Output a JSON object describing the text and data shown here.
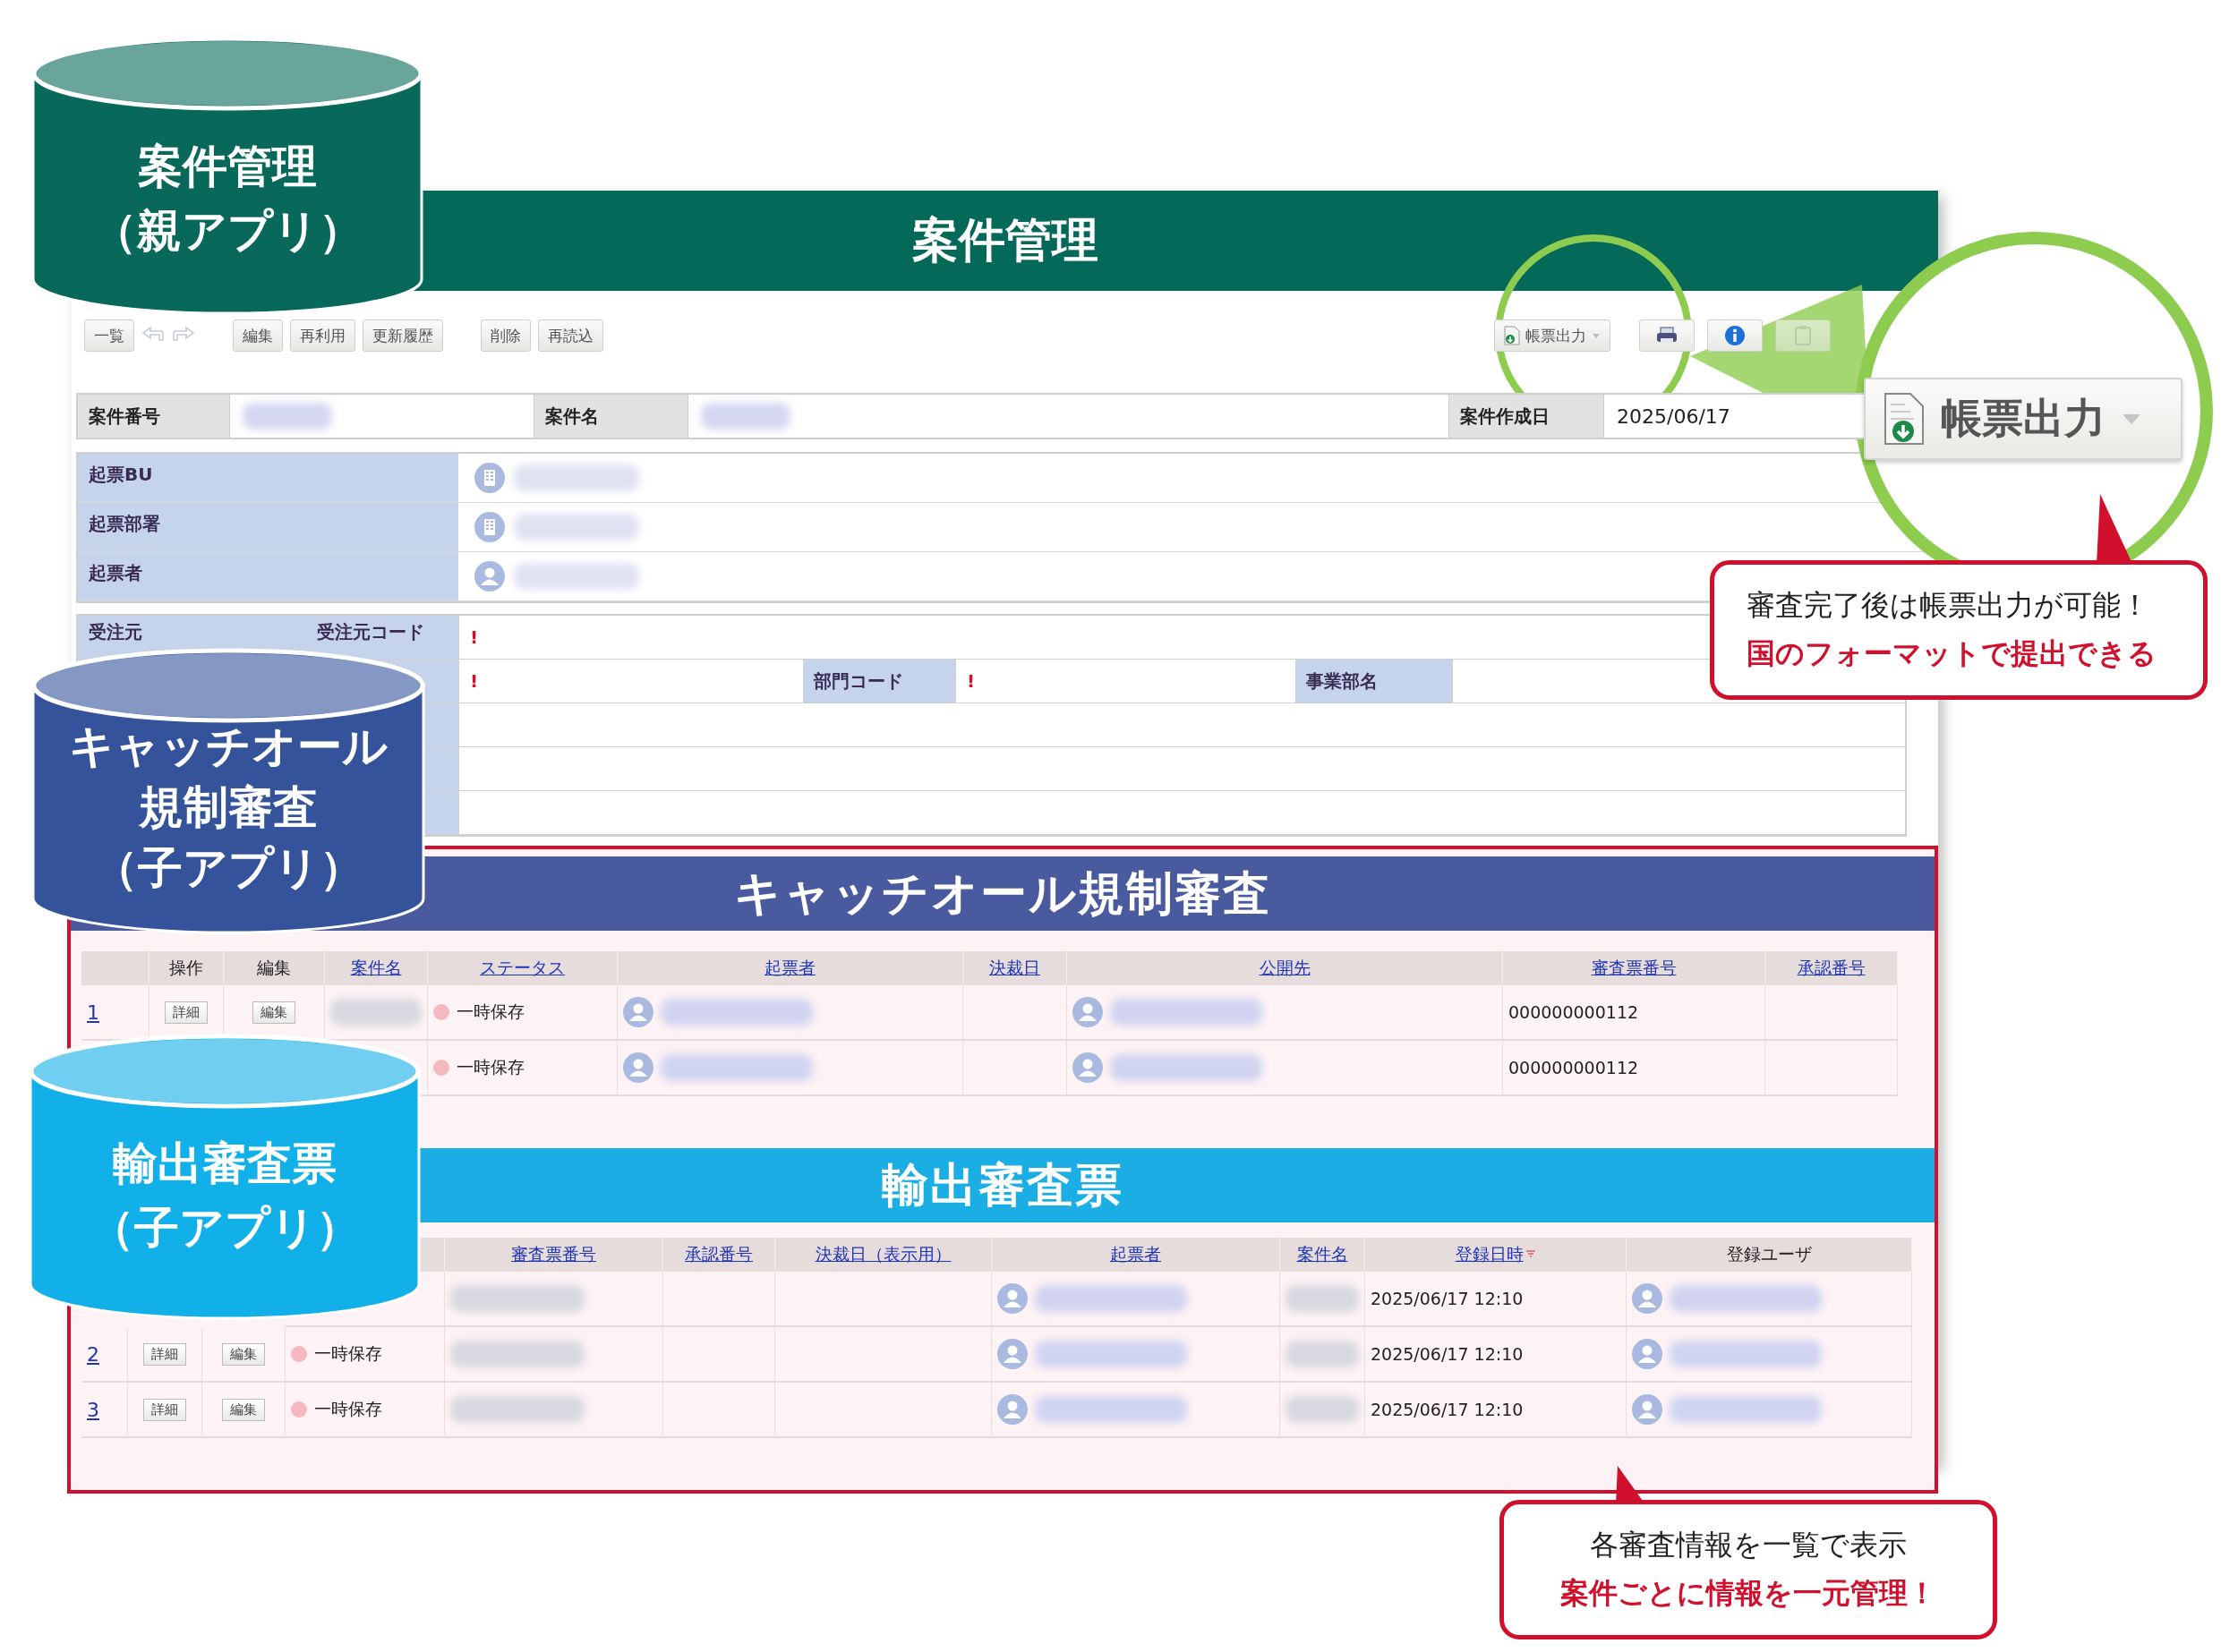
{
  "cylinders": [
    {
      "lines": [
        "案件管理",
        "（親アプリ）"
      ],
      "color": "#08695a"
    },
    {
      "lines": [
        "キャッチオール",
        "規制審査",
        "（子アプリ）"
      ],
      "color": "#34539b"
    },
    {
      "lines": [
        "輸出審査票",
        "（子アプリ）"
      ],
      "color": "#12b0e8"
    }
  ],
  "screen": {
    "title": "案件管理",
    "toolbar_left": [
      [
        {
          "kind": "button",
          "label": "一覧"
        },
        {
          "kind": "back"
        },
        {
          "kind": "forward"
        }
      ],
      [
        {
          "kind": "button",
          "label": "編集"
        },
        {
          "kind": "button",
          "label": "再利用"
        },
        {
          "kind": "button",
          "label": "更新履歴"
        }
      ],
      [
        {
          "kind": "button",
          "label": "削除"
        },
        {
          "kind": "button",
          "label": "再読込"
        }
      ]
    ],
    "toolbar_right": [
      {
        "kind": "report",
        "label": "帳票出力"
      },
      {
        "kind": "print"
      },
      {
        "kind": "info"
      },
      {
        "kind": "clipboard"
      }
    ],
    "summary": [
      {
        "label": "案件番号",
        "value": {
          "kind": "blurred"
        }
      },
      {
        "label": "案件名",
        "value": {
          "kind": "blurred"
        }
      },
      {
        "label": "案件作成日",
        "value": {
          "kind": "text",
          "text": "2025/06/17"
        }
      }
    ],
    "originator": [
      {
        "label": "起票BU",
        "kind": "building"
      },
      {
        "label": "起票部署",
        "kind": "building"
      },
      {
        "label": "起票者",
        "kind": "person"
      }
    ],
    "order_rows": [
      [
        {
          "kind": "label",
          "text": "受注元"
        },
        {
          "kind": "label",
          "text": "受注元コード"
        },
        {
          "kind": "required",
          "text": "!"
        }
      ],
      [
        {
          "kind": "label"
        },
        {
          "kind": "required",
          "text": "!"
        },
        {
          "kind": "label",
          "text": "部門コード"
        },
        {
          "kind": "required",
          "text": "!"
        },
        {
          "kind": "label",
          "text": "事業部名"
        },
        {
          "kind": "value"
        }
      ],
      [
        {
          "kind": "label"
        },
        {
          "kind": "value"
        }
      ],
      [
        {
          "kind": "label"
        },
        {
          "kind": "value"
        }
      ],
      [
        {
          "kind": "label"
        },
        {
          "kind": "value"
        }
      ]
    ],
    "sections": [
      {
        "title": "キャッチオール規制審査",
        "color": "#4a5a9e",
        "columns": [
          {
            "kind": "blank"
          },
          {
            "kind": "plain",
            "label": "操作"
          },
          {
            "kind": "plain",
            "label": "編集"
          },
          {
            "kind": "link",
            "label": "案件名"
          },
          {
            "kind": "link",
            "label": "ステータス"
          },
          {
            "kind": "link",
            "label": "起票者"
          },
          {
            "kind": "link",
            "label": "決裁日"
          },
          {
            "kind": "link",
            "label": "公開先"
          },
          {
            "kind": "link",
            "label": "審査票番号"
          },
          {
            "kind": "link",
            "label": "承認番号"
          }
        ],
        "rows": [
          [
            {
              "kind": "link",
              "text": "1"
            },
            {
              "kind": "button",
              "text": "詳細"
            },
            {
              "kind": "button",
              "text": "編集"
            },
            {
              "kind": "blurred"
            },
            {
              "kind": "status",
              "text": "一時保存"
            },
            {
              "kind": "person"
            },
            {
              "kind": "empty"
            },
            {
              "kind": "person"
            },
            {
              "kind": "text",
              "text": "000000000112"
            },
            {
              "kind": "empty"
            }
          ],
          [
            {
              "kind": "covered"
            },
            {
              "kind": "covered"
            },
            {
              "kind": "covered"
            },
            {
              "kind": "empty"
            },
            {
              "kind": "status",
              "text": "一時保存"
            },
            {
              "kind": "person"
            },
            {
              "kind": "empty"
            },
            {
              "kind": "person"
            },
            {
              "kind": "text",
              "text": "000000000112"
            },
            {
              "kind": "empty"
            }
          ]
        ]
      },
      {
        "title": "輸出審査票",
        "color": "#1aaee5",
        "columns": [
          {
            "kind": "covered"
          },
          {
            "kind": "covered"
          },
          {
            "kind": "covered"
          },
          {
            "kind": "blank"
          },
          {
            "kind": "link",
            "label": "審査票番号"
          },
          {
            "kind": "link",
            "label": "承認番号"
          },
          {
            "kind": "link",
            "label": "決裁日（表示用）"
          },
          {
            "kind": "link",
            "label": "起票者"
          },
          {
            "kind": "link",
            "label": "案件名"
          },
          {
            "kind": "sort",
            "label": "登録日時"
          },
          {
            "kind": "plain",
            "label": "登録ユーザ"
          }
        ],
        "rows": [
          [
            {
              "kind": "covered"
            },
            {
              "kind": "covered"
            },
            {
              "kind": "covered"
            },
            {
              "kind": "empty"
            },
            {
              "kind": "blurred"
            },
            {
              "kind": "empty"
            },
            {
              "kind": "empty"
            },
            {
              "kind": "person"
            },
            {
              "kind": "blurred"
            },
            {
              "kind": "text",
              "text": "2025/06/17 12:10"
            },
            {
              "kind": "person"
            }
          ],
          [
            {
              "kind": "link",
              "text": "2"
            },
            {
              "kind": "button",
              "text": "詳細"
            },
            {
              "kind": "button",
              "text": "編集"
            },
            {
              "kind": "status",
              "text": "一時保存"
            },
            {
              "kind": "blurred"
            },
            {
              "kind": "empty"
            },
            {
              "kind": "empty"
            },
            {
              "kind": "person"
            },
            {
              "kind": "blurred"
            },
            {
              "kind": "text",
              "text": "2025/06/17 12:10"
            },
            {
              "kind": "person"
            }
          ],
          [
            {
              "kind": "link",
              "text": "3"
            },
            {
              "kind": "button",
              "text": "詳細"
            },
            {
              "kind": "button",
              "text": "編集"
            },
            {
              "kind": "status",
              "text": "一時保存"
            },
            {
              "kind": "blurred"
            },
            {
              "kind": "empty"
            },
            {
              "kind": "empty"
            },
            {
              "kind": "person"
            },
            {
              "kind": "blurred"
            },
            {
              "kind": "text",
              "text": "2025/06/17 12:10"
            },
            {
              "kind": "person"
            }
          ]
        ]
      }
    ]
  },
  "zoom": {
    "label": "帳票出力"
  },
  "callouts": [
    {
      "lines": [
        {
          "text": "審査完了後は帳票出力が可能！",
          "emphasis": false
        },
        {
          "text": "国のフォーマットで提出できる",
          "emphasis": true
        }
      ]
    },
    {
      "lines": [
        {
          "text": "各審査情報を一覧で表示",
          "emphasis": false
        },
        {
          "text": "案件ごとに情報を一元管理！",
          "emphasis": true
        }
      ]
    }
  ]
}
